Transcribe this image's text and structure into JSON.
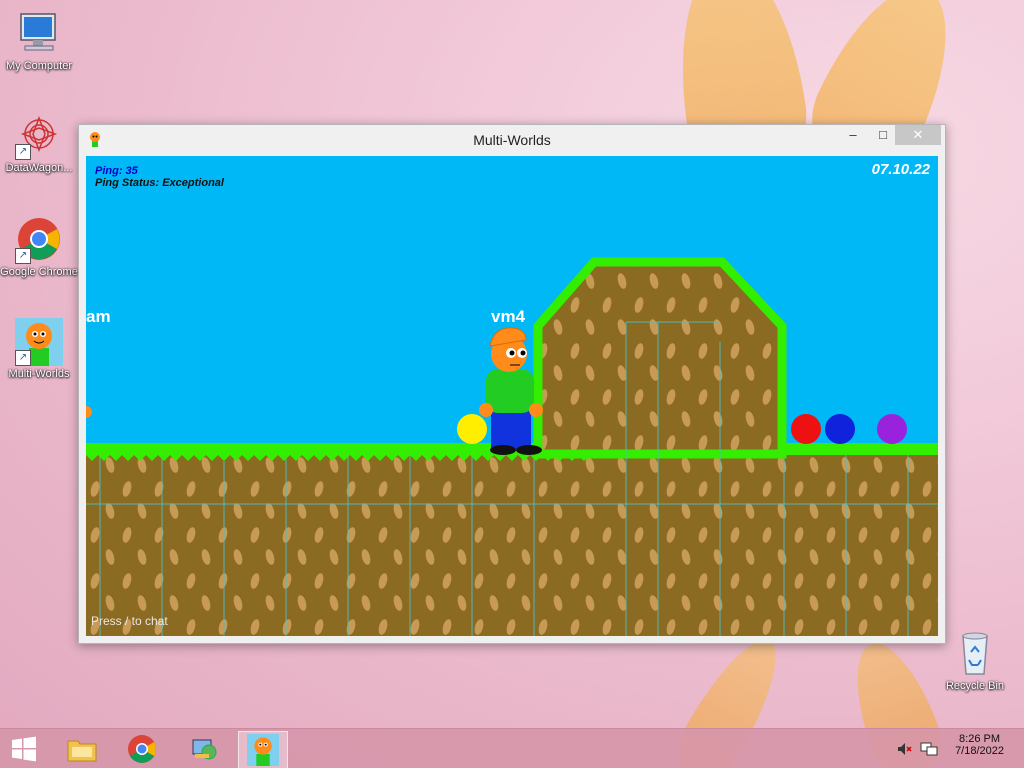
{
  "desktop": {
    "icons": [
      {
        "label": "My Computer"
      },
      {
        "label": "DataWagon..."
      },
      {
        "label": "Google Chrome"
      },
      {
        "label": "Multi-Worlds"
      },
      {
        "label": "Recycle Bin"
      }
    ]
  },
  "window": {
    "title": "Multi-Worlds",
    "minimize": "–",
    "maximize": "□",
    "close": "✕"
  },
  "game": {
    "ping_label": "Ping: 35",
    "ping_status": "Ping Status: Exceptional",
    "date": "07.10.22",
    "chat_hint": "Press / to chat",
    "player_name": "vm4",
    "other_player_name": "am",
    "orbs": [
      {
        "color": "#ffee00"
      },
      {
        "color": "#ee1111"
      },
      {
        "color": "#1122dd"
      },
      {
        "color": "#9922dd"
      }
    ],
    "colors": {
      "sky": "#00b8f5",
      "grass": "#33ee00",
      "dirt": "#8b6a22",
      "dirt_spot": "#c79a55"
    }
  },
  "taskbar": {
    "items": [
      "start-button",
      "file-explorer",
      "google-chrome",
      "datawagon",
      "multi-worlds"
    ],
    "time": "8:26 PM",
    "date": "7/18/2022"
  }
}
